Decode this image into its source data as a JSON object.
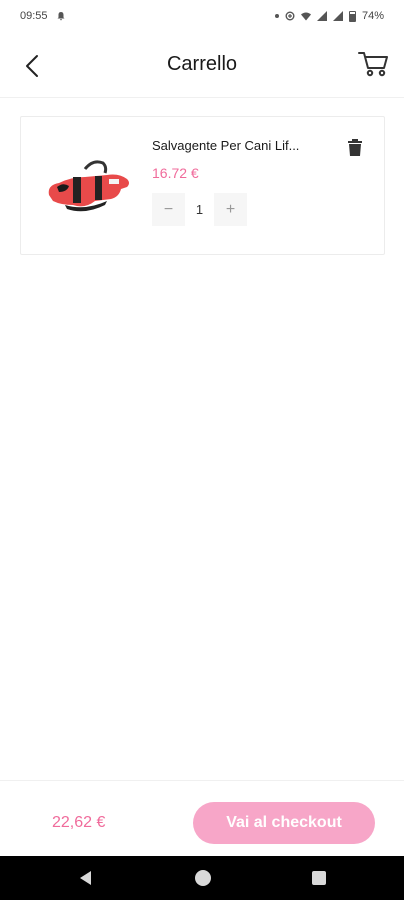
{
  "status_bar": {
    "time": "09:55",
    "battery": "74%"
  },
  "header": {
    "title": "Carrello",
    "back_icon": "chevron-left-icon",
    "cart_icon": "shopping-cart-icon"
  },
  "cart": {
    "items": [
      {
        "name": "Salvagente Per Cani Lif...",
        "price": "16.72 €",
        "quantity": "1",
        "decrement_label": "−",
        "increment_label": "+",
        "image_icon": "dog-life-jacket-image",
        "delete_icon": "trash-icon"
      }
    ]
  },
  "footer": {
    "total": "22,62 €",
    "checkout_label": "Vai al checkout"
  },
  "colors": {
    "accent": "#f06b9b",
    "button": "#f7a6c8"
  }
}
